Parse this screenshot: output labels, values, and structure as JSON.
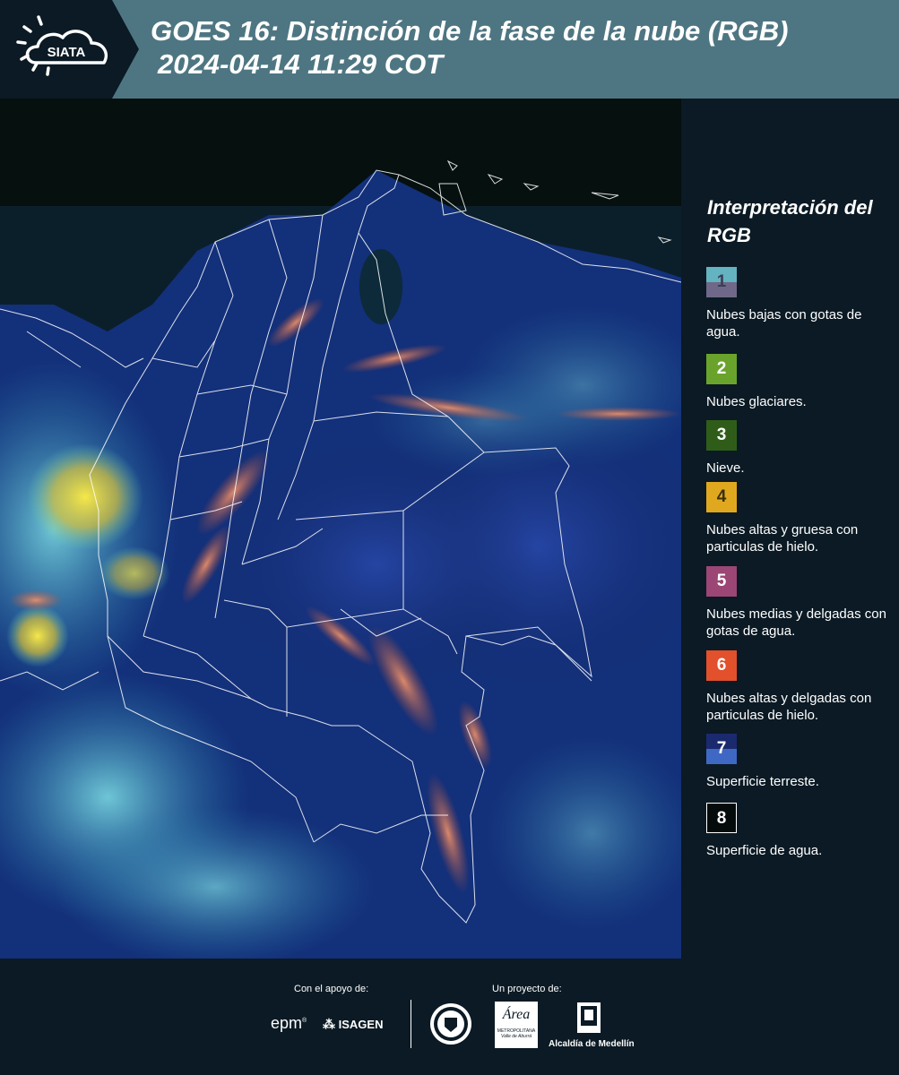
{
  "header": {
    "logo_text": "SIATA",
    "title_line1": "GOES 16: Distinción de la fase de la nube (RGB)",
    "title_line2": "2024-04-14 11:29 COT"
  },
  "legend": {
    "title": "Interpretación del RGB",
    "items": [
      {
        "number": "1",
        "label": "Nubes bajas con gotas de agua.",
        "color_top": "#63b3c1",
        "color_bottom": "#6f6888"
      },
      {
        "number": "2",
        "label": "Nubes glaciares.",
        "color": "#6aa32c"
      },
      {
        "number": "3",
        "label": "Nieve.",
        "color": "#2f5d19"
      },
      {
        "number": "4",
        "label": "Nubes altas y gruesa con particulas de hielo.",
        "color": "#e0a81e"
      },
      {
        "number": "5",
        "label": "Nubes medias y delgadas con gotas de agua.",
        "color": "#9b4674"
      },
      {
        "number": "6",
        "label": "Nubes altas y delgadas con particulas de hielo.",
        "color": "#e2502c"
      },
      {
        "number": "7",
        "label": "Superficie terreste.",
        "color_top": "#1b2a6e",
        "color_bottom": "#3f68c4"
      },
      {
        "number": "8",
        "label": "Superficie de agua.",
        "color": "#050a0a"
      }
    ]
  },
  "footer": {
    "support_label": "Con el apoyo de:",
    "project_label": "Un proyecto de:",
    "sponsor_epm": "epm",
    "sponsor_isagen": "ISAGEN",
    "area_name": "Área",
    "area_sub": "METROPOLITANA",
    "area_sub2": "Valle de Aburrá",
    "alcaldia": "Alcaldía de Medellín"
  }
}
